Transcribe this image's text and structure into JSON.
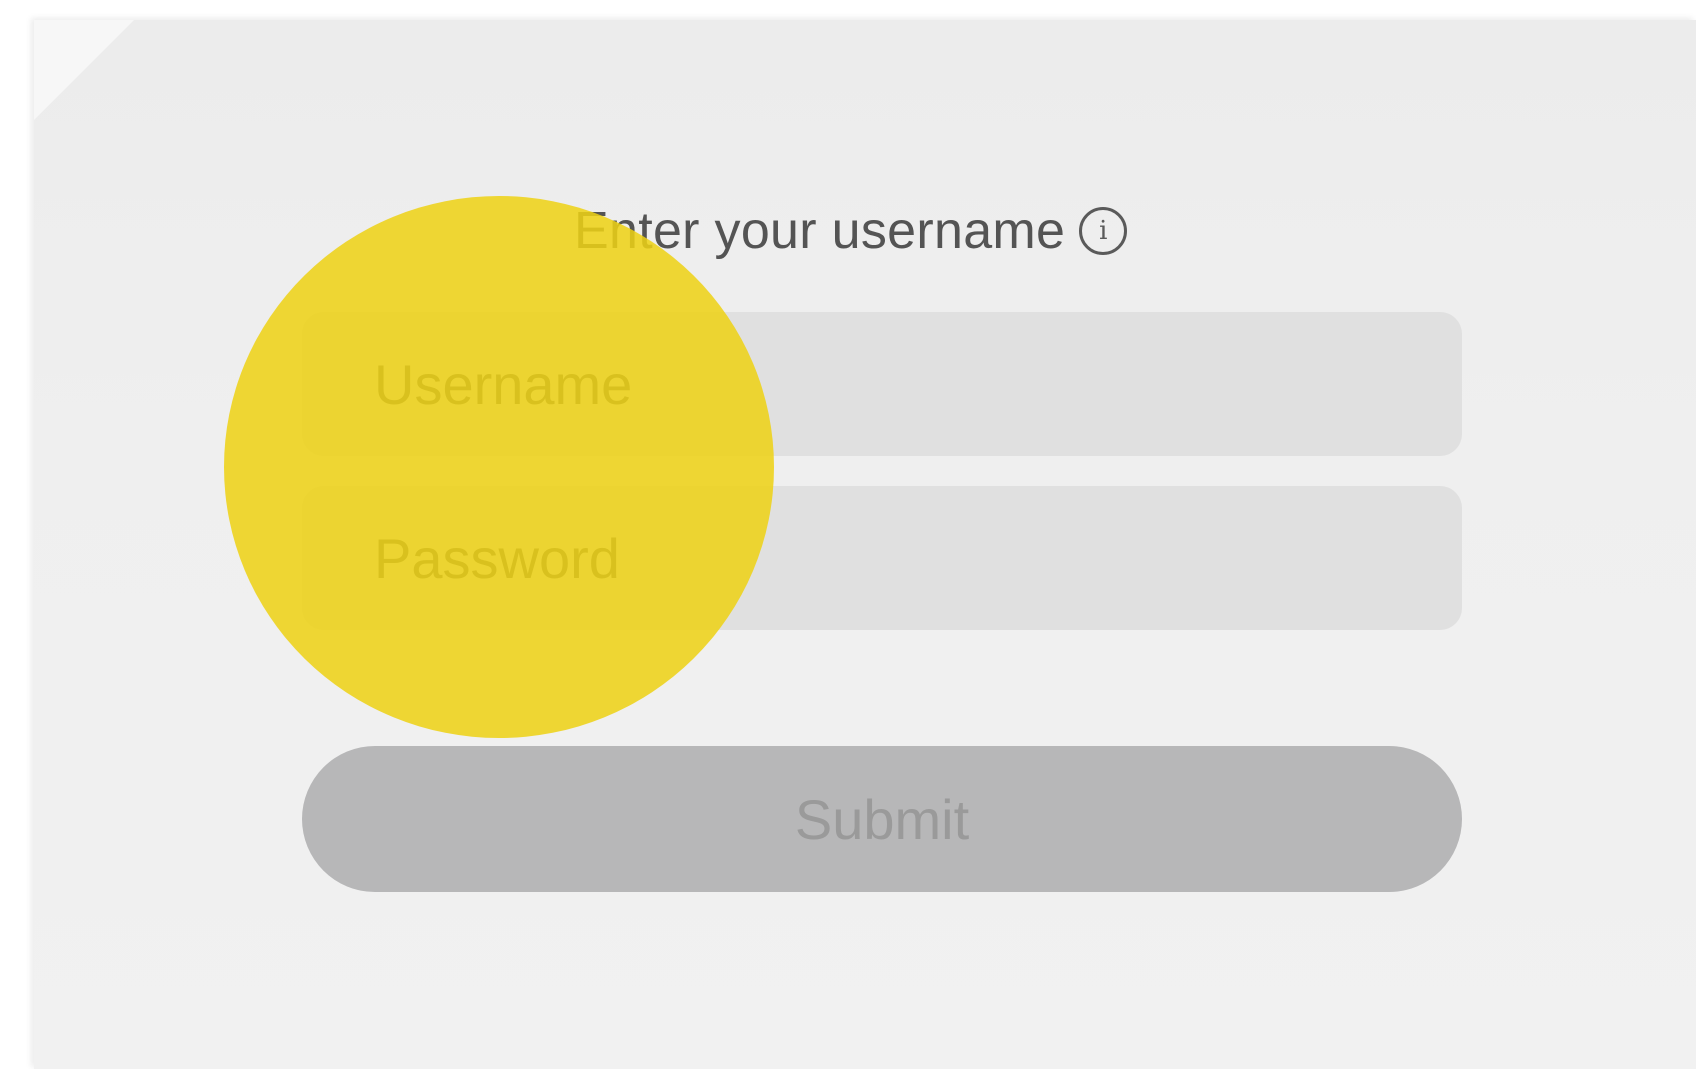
{
  "form": {
    "prompt": "Enter your username",
    "info_icon": "info-icon",
    "username_placeholder": "Username",
    "username_value": "",
    "password_placeholder": "Password",
    "password_value": "",
    "submit_label": "Submit"
  },
  "colors": {
    "background": "#efefef",
    "field_background": "#e0e0e0",
    "submit_background": "#b7b7b8",
    "submit_text": "#9a9a9a",
    "highlight": "#eed214"
  }
}
